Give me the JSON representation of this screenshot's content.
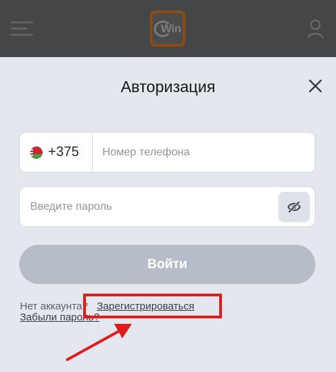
{
  "header": {
    "menu_icon": "hamburger-icon",
    "logo_text": "Win",
    "profile_icon": "user-icon"
  },
  "modal": {
    "title": "Авторизация",
    "close_icon": "close-icon",
    "phone": {
      "country_flag": "belarus-flag-icon",
      "country_code": "+375",
      "placeholder": "Номер телефона",
      "value": ""
    },
    "password": {
      "placeholder": "Введите пароль",
      "value": "",
      "toggle_icon": "eye-slash-icon"
    },
    "login_button": "Войти",
    "no_account_text": "Нет аккаунта?",
    "register_link": "Зарегистрироваться",
    "forgot_link": "Забыли пароль?"
  },
  "annotation": {
    "color": "#e01c1c"
  },
  "colors": {
    "header_bg": "#444648",
    "page_bg": "#e4e7ee",
    "button_disabled": "#b6bcc8"
  }
}
